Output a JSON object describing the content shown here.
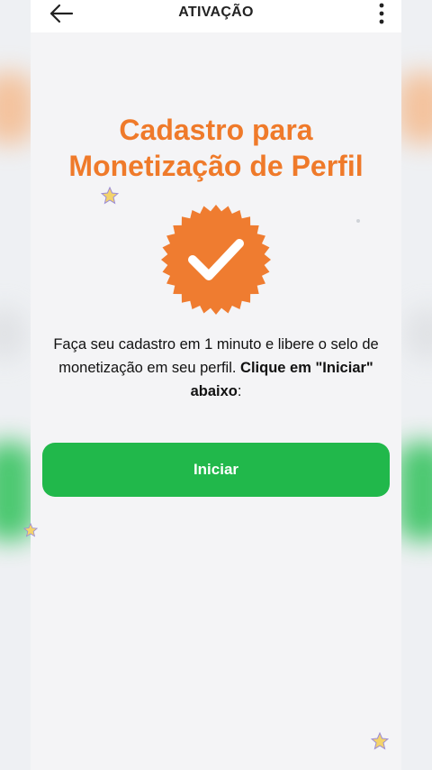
{
  "topbar": {
    "title": "ATIVAÇÃO",
    "back_icon": "arrow-left-icon",
    "menu_icon": "more-vertical-icon"
  },
  "main": {
    "headline_line1": "Cadastro para",
    "headline_line2": "Monetização de Perfil",
    "seal_icon": "verified-badge-icon",
    "description_prefix": "Faça seu cadastro em 1 minuto e libere o selo de monetização em seu perfil.",
    "description_bold": "Clique em \"Iniciar\" abaixo",
    "description_suffix": ":",
    "start_button_label": "Iniciar"
  },
  "colors": {
    "accent_orange": "#ef7a2a",
    "button_green": "#21b84b",
    "background": "#f4f4f6"
  }
}
